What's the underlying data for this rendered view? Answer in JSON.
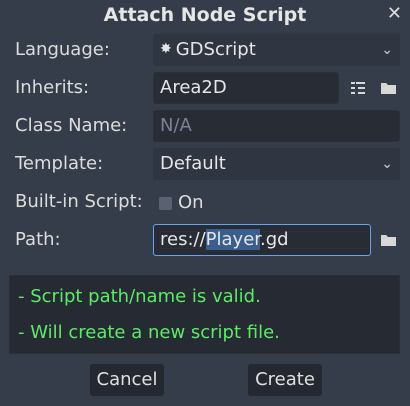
{
  "dialog": {
    "title": "Attach Node Script",
    "close_glyph": "✕"
  },
  "language": {
    "label": "Language:",
    "value": "GDScript",
    "options_selected": "GDScript"
  },
  "inherits": {
    "label": "Inherits:",
    "value": "Area2D"
  },
  "class_name": {
    "label": "Class Name:",
    "placeholder": "N/A"
  },
  "template": {
    "label": "Template:",
    "value": "Default"
  },
  "builtin": {
    "label": "Built-in Script:",
    "checkbox_label": "On",
    "checked": false
  },
  "path": {
    "label": "Path:",
    "prefix": "res://",
    "selected": "Player",
    "suffix": ".gd"
  },
  "messages": [
    "- Script path/name is valid.",
    "- Will create a new script file."
  ],
  "buttons": {
    "cancel": "Cancel",
    "create": "Create"
  },
  "colors": {
    "valid_message": "#5fe86a",
    "focus_border": "#6aa1ea",
    "selection": "#3a5e8e"
  },
  "icons": [
    "gear-icon",
    "chevron-down-icon",
    "node-tree-icon",
    "folder-icon",
    "close-icon"
  ]
}
